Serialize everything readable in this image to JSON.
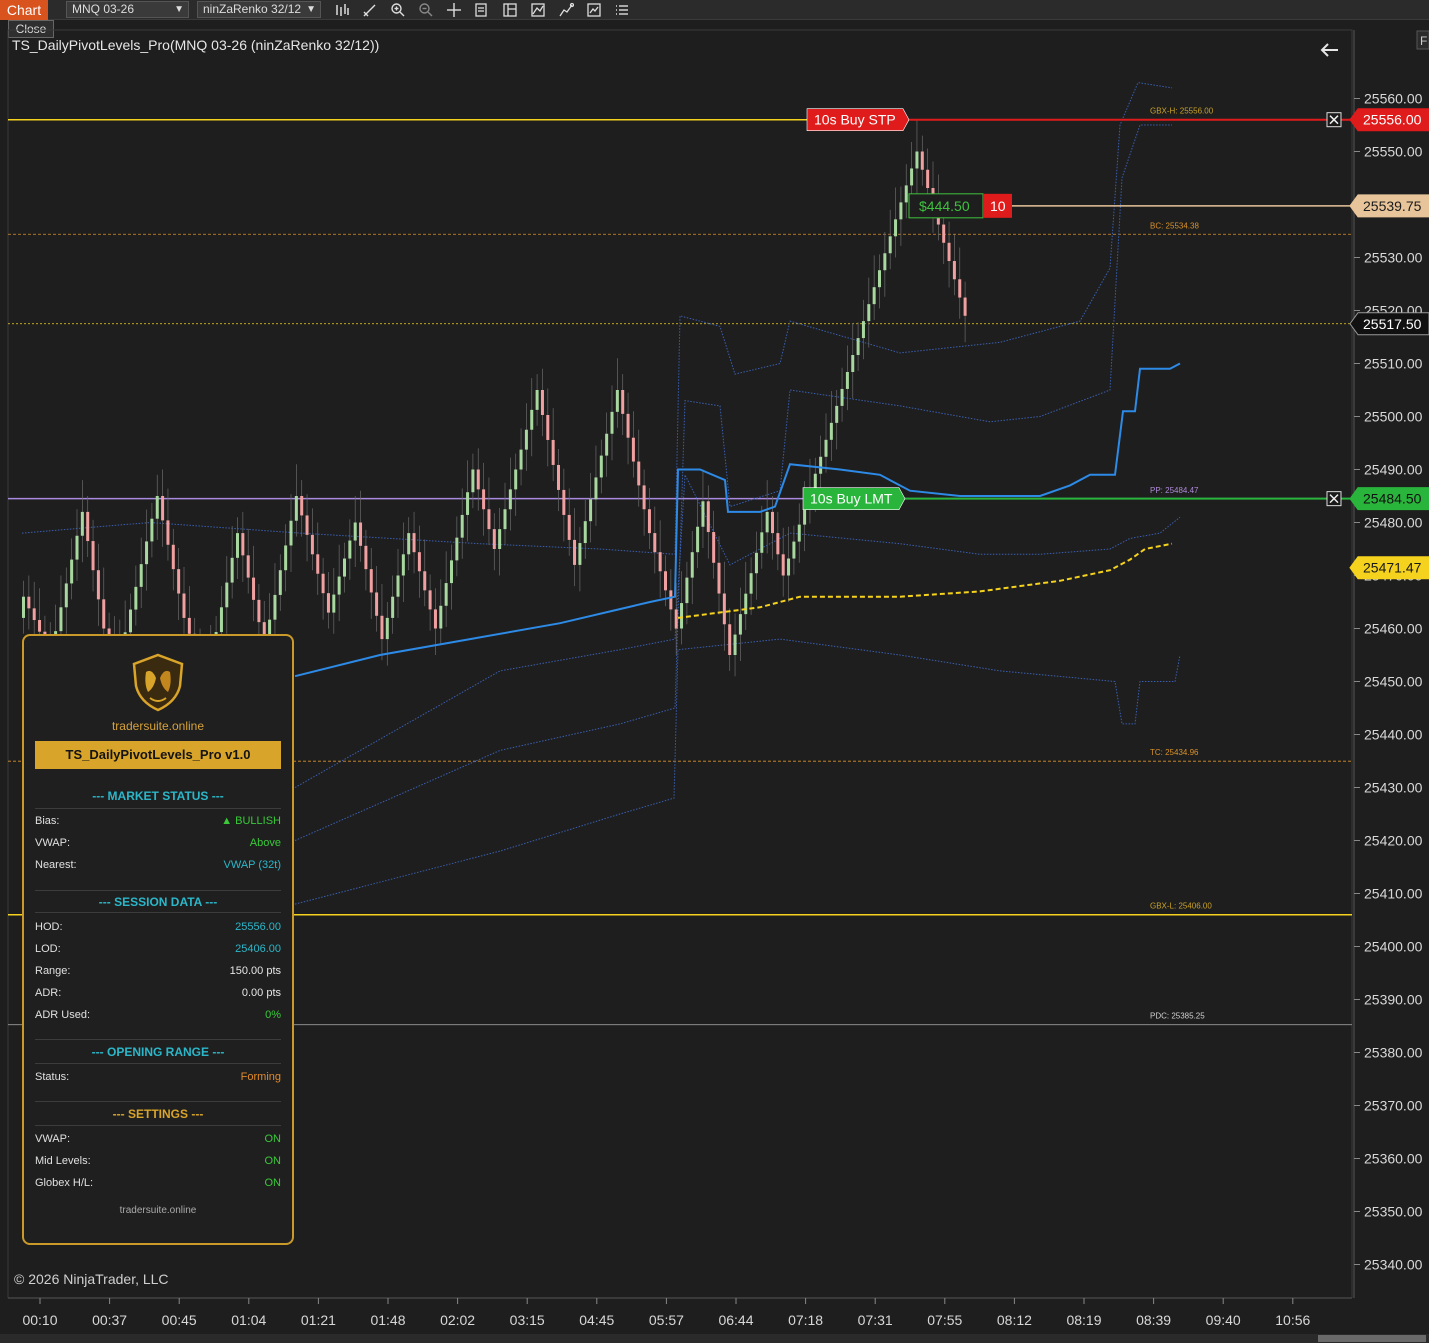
{
  "toolbar": {
    "tab_label": "Chart",
    "instrument": "MNQ 03-26",
    "bars_type": "ninZaRenko 32/12",
    "close_label": "Close",
    "right_tab": "F"
  },
  "indicator_title": "TS_DailyPivotLevels_Pro(MNQ 03-26 (ninZaRenko 32/12))",
  "copyright": "© 2026 NinjaTrader, LLC",
  "price_axis": {
    "ticks": [
      "25560.00",
      "25550.00",
      "25540.00",
      "25530.00",
      "25520.00",
      "25510.00",
      "25500.00",
      "25490.00",
      "25480.00",
      "25470.00",
      "25460.00",
      "25450.00",
      "25440.00",
      "25430.00",
      "25420.00",
      "25410.00",
      "25400.00",
      "25390.00",
      "25380.00",
      "25370.00",
      "25360.00",
      "25350.00",
      "25340.00"
    ],
    "markers": [
      {
        "label": "25556.00",
        "price": 25556.0,
        "color": "#e01b1b",
        "text_color": "#ffffff"
      },
      {
        "label": "25539.75",
        "price": 25539.75,
        "color": "#e8c49a",
        "text_color": "#1a1a1a"
      },
      {
        "label": "25517.50",
        "price": 25517.5,
        "color": "#111111",
        "text_color": "#ffffff"
      },
      {
        "label": "25484.50",
        "price": 25484.5,
        "color": "#29b53b",
        "text_color": "#111111"
      },
      {
        "label": "25471.47",
        "price": 25471.47,
        "color": "#f5d21d",
        "text_color": "#1a1a1a"
      }
    ]
  },
  "time_axis": [
    "00:10",
    "00:37",
    "00:45",
    "01:04",
    "01:21",
    "01:48",
    "02:02",
    "03:15",
    "04:45",
    "05:57",
    "06:44",
    "07:18",
    "07:31",
    "07:55",
    "08:12",
    "08:19",
    "08:39",
    "09:40",
    "10:56"
  ],
  "orders": {
    "stop": {
      "label": "10s  Buy STP",
      "price": 25556.0
    },
    "limit": {
      "label": "10s  Buy LMT",
      "price": 25484.5
    },
    "position": {
      "pnl": "$444.50",
      "qty": "10",
      "price": 25539.75
    }
  },
  "level_labels": [
    {
      "text": "GBX-H: 25556.00",
      "price": 25556.0,
      "color": "#c9a227"
    },
    {
      "text": "BC: 25534.38",
      "price": 25534.38,
      "color": "#d9922a"
    },
    {
      "text": "PP: 25484.47",
      "price": 25484.47,
      "color": "#b08ad8"
    },
    {
      "text": "TC: 25434.96",
      "price": 25434.96,
      "color": "#d9922a"
    },
    {
      "text": "GBX-L: 25406.00",
      "price": 25406.0,
      "color": "#c9a227"
    },
    {
      "text": "PDC: 25385.25",
      "price": 25385.25,
      "color": "#d0d0d0"
    }
  ],
  "colors": {
    "up_bar": "#a8d8a0",
    "down_bar": "#f0a0a0",
    "vwap": "#2d8ae6",
    "band": "#3a5fb0",
    "gold": "#f5d21d",
    "panel_border": "#c99a2a"
  },
  "panel": {
    "site": "tradersuite.online",
    "title": "TS_DailyPivotLevels_Pro v1.0",
    "market_status": {
      "heading": "--- MARKET STATUS ---",
      "rows": [
        {
          "label": "Bias:",
          "value": "▲ BULLISH",
          "color": "#39c939"
        },
        {
          "label": "VWAP:",
          "value": "Above",
          "color": "#39c939"
        },
        {
          "label": "Nearest:",
          "value": "VWAP (32t)",
          "color": "#2bb7c9"
        }
      ]
    },
    "session_data": {
      "heading": "--- SESSION DATA ---",
      "rows": [
        {
          "label": "HOD:",
          "value": "25556.00",
          "color": "#2bb7c9"
        },
        {
          "label": "LOD:",
          "value": "25406.00",
          "color": "#2bb7c9"
        },
        {
          "label": "Range:",
          "value": "150.00 pts",
          "color": "#e6e6e6"
        },
        {
          "label": "ADR:",
          "value": "0.00 pts",
          "color": "#e6e6e6"
        },
        {
          "label": "ADR Used:",
          "value": "0%",
          "color": "#39c939"
        }
      ]
    },
    "opening_range": {
      "heading": "--- OPENING RANGE ---",
      "rows": [
        {
          "label": "Status:",
          "value": "Forming",
          "color": "#e08a2a"
        }
      ]
    },
    "settings": {
      "heading": "--- SETTINGS ---",
      "rows": [
        {
          "label": "VWAP:",
          "value": "ON",
          "color": "#39c939"
        },
        {
          "label": "Mid Levels:",
          "value": "ON",
          "color": "#39c939"
        },
        {
          "label": "Globex H/L:",
          "value": "ON",
          "color": "#39c939"
        }
      ]
    },
    "footer": "tradersuite.online"
  }
}
